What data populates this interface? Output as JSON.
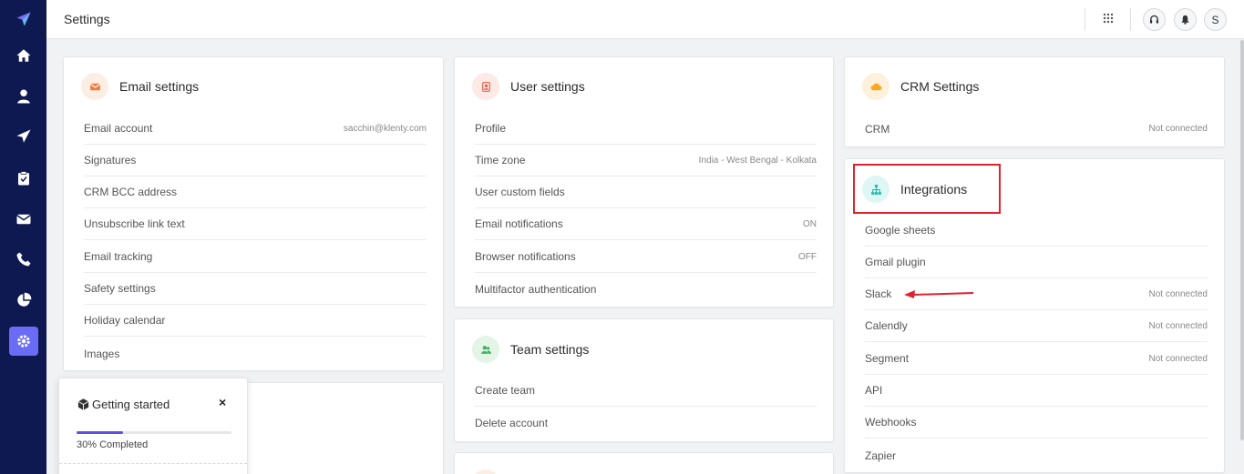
{
  "sidebar": {
    "items": [
      {
        "icon": "logo-icon"
      },
      {
        "icon": "home-icon"
      },
      {
        "icon": "user-icon"
      },
      {
        "icon": "send-icon"
      },
      {
        "icon": "clipboard-icon"
      },
      {
        "icon": "mail-icon"
      },
      {
        "icon": "phone-icon"
      },
      {
        "icon": "pie-chart-icon"
      },
      {
        "icon": "settings-icon",
        "active": true
      }
    ],
    "accent": "#6a6cf6",
    "background": "#0f1951"
  },
  "header": {
    "title": "Settings",
    "avatar_initial": "S"
  },
  "email_settings": {
    "title": "Email settings",
    "rows": [
      {
        "label": "Email account",
        "value": "sacchin@klenty.com"
      },
      {
        "label": "Signatures",
        "value": ""
      },
      {
        "label": "CRM BCC address",
        "value": ""
      },
      {
        "label": "Unsubscribe link text",
        "value": ""
      },
      {
        "label": "Email tracking",
        "value": ""
      },
      {
        "label": "Safety settings",
        "value": ""
      },
      {
        "label": "Holiday calendar",
        "value": ""
      },
      {
        "label": "Images",
        "value": ""
      }
    ]
  },
  "user_settings": {
    "title": "User settings",
    "rows": [
      {
        "label": "Profile",
        "value": ""
      },
      {
        "label": "Time zone",
        "value": "India - West Bengal - Kolkata"
      },
      {
        "label": "User custom fields",
        "value": ""
      },
      {
        "label": "Email notifications",
        "value": "ON"
      },
      {
        "label": "Browser notifications",
        "value": "OFF"
      },
      {
        "label": "Multifactor authentication",
        "value": ""
      }
    ]
  },
  "team_settings": {
    "title": "Team settings",
    "rows": [
      {
        "label": "Create team",
        "value": ""
      },
      {
        "label": "Delete account",
        "value": ""
      }
    ]
  },
  "crm_settings": {
    "title": "CRM Settings",
    "rows": [
      {
        "label": "CRM",
        "value": "Not connected"
      }
    ]
  },
  "integrations": {
    "title": "Integrations",
    "rows": [
      {
        "label": "Google sheets",
        "value": ""
      },
      {
        "label": "Gmail plugin",
        "value": ""
      },
      {
        "label": "Slack",
        "value": "Not connected"
      },
      {
        "label": "Calendly",
        "value": "Not connected"
      },
      {
        "label": "Segment",
        "value": "Not connected"
      },
      {
        "label": "API",
        "value": ""
      },
      {
        "label": "Webhooks",
        "value": ""
      },
      {
        "label": "Zapier",
        "value": ""
      }
    ]
  },
  "getting_started": {
    "title": "Getting started",
    "close": "×",
    "progress": 0.3,
    "progress_text": "30% Completed"
  },
  "annotation": {
    "highlight_color": "#e2212a"
  }
}
